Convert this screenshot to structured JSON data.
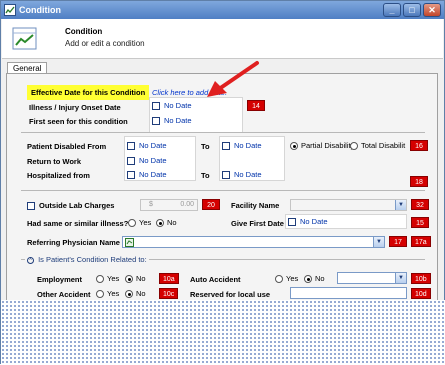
{
  "window": {
    "title": "Condition"
  },
  "header": {
    "title": "Condition",
    "subtitle": "Add or edit a condition"
  },
  "tabs": [
    {
      "label": "General"
    }
  ],
  "effective_date": {
    "label": "Effective Date for this Condition",
    "link": "Click here to add date."
  },
  "onset": {
    "label": "Illness / Injury Onset Date",
    "checkbox": "No Date",
    "badge": "14"
  },
  "first_seen": {
    "label": "First seen for this condition",
    "checkbox": "No Date"
  },
  "disabled": {
    "label": "Patient Disabled From",
    "checkbox": "No Date",
    "to_label": "To",
    "to_checkbox": "No Date",
    "partial": "Partial Disability",
    "total": "Total Disabilit",
    "badge": "16"
  },
  "return_work": {
    "label": "Return to Work",
    "checkbox": "No Date"
  },
  "hospitalized": {
    "label": "Hospitalized from",
    "checkbox": "No Date",
    "to_label": "To",
    "to_checkbox": "No Date",
    "badge": "18"
  },
  "outside_lab": {
    "label": "Outside Lab Charges",
    "amount": "0.00",
    "currency": "$",
    "badge": "20"
  },
  "facility": {
    "label": "Facility Name",
    "badge": "32"
  },
  "similar": {
    "label": "Had same or similar illness?",
    "yes": "Yes",
    "no": "No"
  },
  "give_first": {
    "label": "Give First Date",
    "checkbox": "No Date",
    "badge": "15"
  },
  "referring": {
    "label": "Referring Physician Name",
    "badge1": "17",
    "badge2": "17a"
  },
  "related": {
    "title": "Is Patient's Condition Related to:",
    "employment": {
      "label": "Employment",
      "yes": "Yes",
      "no": "No",
      "badge": "10a"
    },
    "auto": {
      "label": "Auto Accident",
      "yes": "Yes",
      "no": "No",
      "badge": "10b"
    },
    "other": {
      "label": "Other Accident",
      "yes": "Yes",
      "no": "No",
      "badge": "10c"
    },
    "reserved": {
      "label": "Reserved for local use",
      "badge": "10d"
    }
  },
  "colors": {
    "highlight": "#ffff33",
    "badge": "#d40000",
    "link": "#0033cc",
    "arrow": "#e02020"
  }
}
